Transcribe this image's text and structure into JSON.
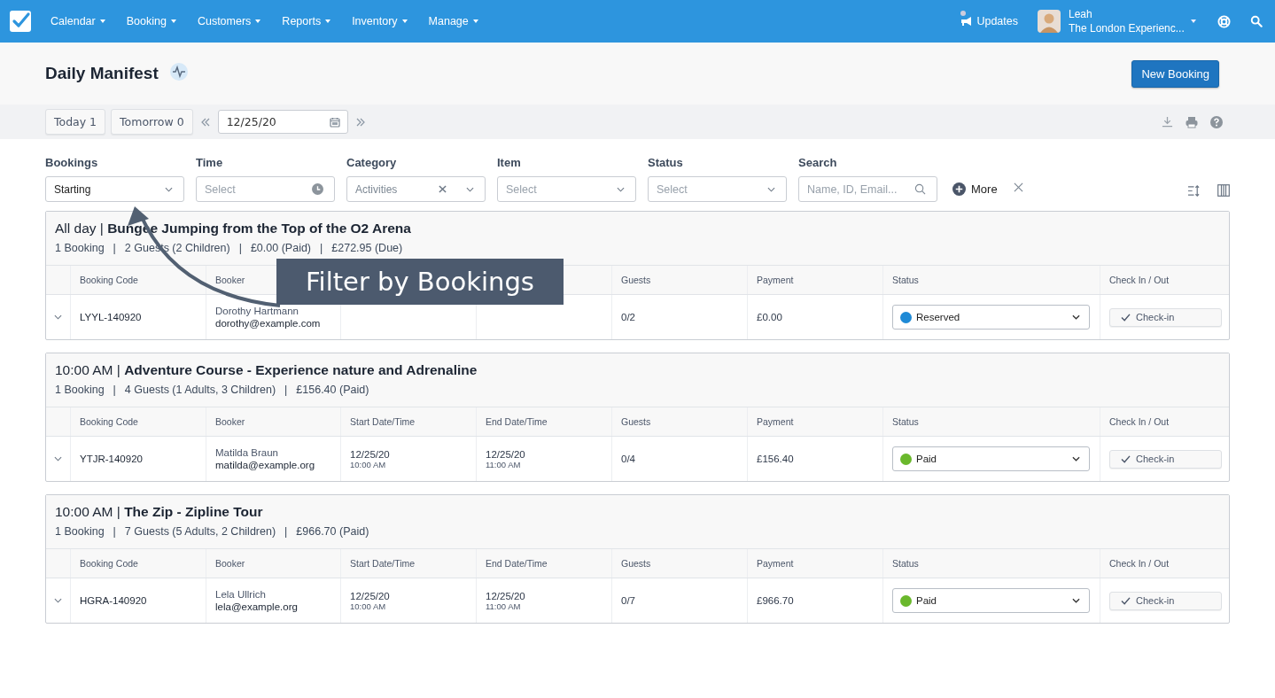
{
  "nav": {
    "menus": [
      "Calendar",
      "Booking",
      "Customers",
      "Reports",
      "Inventory",
      "Manage"
    ],
    "updates": "Updates",
    "user": {
      "name": "Leah",
      "org": "The London Experienc..."
    }
  },
  "page": {
    "title": "Daily Manifest",
    "new_button": "New Booking"
  },
  "toolbar": {
    "today": "Today 1",
    "tomorrow": "Tomorrow 0",
    "date": "12/25/20"
  },
  "filters": [
    {
      "label": "Bookings",
      "kind": "select",
      "value": "Starting"
    },
    {
      "label": "Time",
      "kind": "time",
      "placeholder": "Select"
    },
    {
      "label": "Category",
      "kind": "clearable",
      "value": "Activities"
    },
    {
      "label": "Item",
      "kind": "select",
      "placeholder": "Select"
    },
    {
      "label": "Status",
      "kind": "select",
      "placeholder": "Select"
    },
    {
      "label": "Search",
      "kind": "search",
      "placeholder": "Name, ID, Email..."
    }
  ],
  "more": "More",
  "groups": [
    {
      "time": "All day |",
      "title": "Bungee Jumping from the Top of the O2 Arena",
      "summary": [
        "1 Booking",
        "|",
        "2 Guests (2 Children)",
        "|",
        "£0.00 (Paid)",
        "|",
        "£272.95 (Due)"
      ],
      "columns": [
        "Booking Code",
        "Booker",
        null,
        null,
        "Guests",
        "Payment",
        "Status",
        "Check In / Out"
      ],
      "rows": [
        {
          "code": "LYYL-140920",
          "booker_name": "Dorothy Hartmann",
          "booker_email": "dorothy@example.com",
          "guests": "0/2",
          "payment": "£0.00",
          "status": "Reserved",
          "color": "#1f8ad6",
          "checkin": "Check-in"
        }
      ]
    },
    {
      "time": "10:00 AM |",
      "title": "Adventure Course - Experience nature and Adrenaline",
      "summary": [
        "1 Booking",
        "|",
        "4 Guests (1 Adults, 3 Children)",
        "|",
        "£156.40 (Paid)"
      ],
      "columns": [
        "Booking Code",
        "Booker",
        "Start Date/Time",
        "End Date/Time",
        "Guests",
        "Payment",
        "Status",
        "Check In / Out"
      ],
      "rows": [
        {
          "code": "YTJR-140920",
          "booker_name": "Matilda Braun",
          "booker_email": "matilda@example.org",
          "start_date": "12/25/20",
          "start_time": "10:00 AM",
          "end_date": "12/25/20",
          "end_time": "11:00 AM",
          "guests": "0/4",
          "payment": "£156.40",
          "status": "Paid",
          "color": "#6ab82c",
          "checkin": "Check-in"
        }
      ]
    },
    {
      "time": "10:00 AM |",
      "title": "The Zip - Zipline Tour",
      "summary": [
        "1 Booking",
        "|",
        "7 Guests (5 Adults, 2 Children)",
        "|",
        "£966.70 (Paid)"
      ],
      "columns": [
        "Booking Code",
        "Booker",
        "Start Date/Time",
        "End Date/Time",
        "Guests",
        "Payment",
        "Status",
        "Check In / Out"
      ],
      "rows": [
        {
          "code": "HGRA-140920",
          "booker_name": "Lela Ullrich",
          "booker_email": "lela@example.org",
          "start_date": "12/25/20",
          "start_time": "10:00 AM",
          "end_date": "12/25/20",
          "end_time": "11:00 AM",
          "guests": "0/7",
          "payment": "£966.70",
          "status": "Paid",
          "color": "#6ab82c",
          "checkin": "Check-in"
        }
      ]
    }
  ],
  "callout": "Filter by Bookings"
}
